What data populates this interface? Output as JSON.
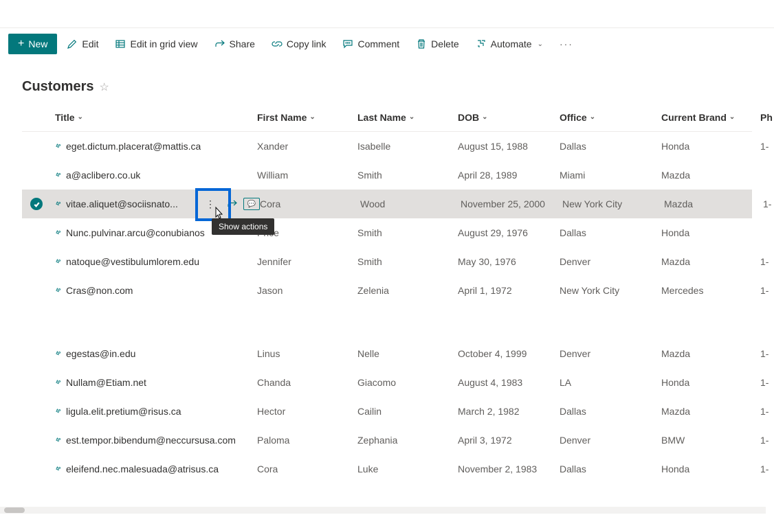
{
  "toolbar": {
    "new_label": "New",
    "edit_label": "Edit",
    "grid_label": "Edit in grid view",
    "share_label": "Share",
    "copy_label": "Copy link",
    "comment_label": "Comment",
    "delete_label": "Delete",
    "automate_label": "Automate"
  },
  "list": {
    "title": "Customers"
  },
  "columns": {
    "title": "Title",
    "first": "First Name",
    "last": "Last Name",
    "dob": "DOB",
    "office": "Office",
    "brand": "Current Brand",
    "phone": "Ph"
  },
  "tooltip": "Show actions",
  "rows": [
    {
      "title": "eget.dictum.placerat@mattis.ca",
      "first": "Xander",
      "last": "Isabelle",
      "dob": "August 15, 1988",
      "office": "Dallas",
      "brand": "Honda",
      "ph": "1-"
    },
    {
      "title": "a@aclibero.co.uk",
      "first": "William",
      "last": "Smith",
      "dob": "April 28, 1989",
      "office": "Miami",
      "brand": "Mazda",
      "ph": ""
    },
    {
      "title": "vitae.aliquet@sociisnato...",
      "first": "Cora",
      "last": "Wood",
      "dob": "November 25, 2000",
      "office": "New York City",
      "brand": "Mazda",
      "ph": "1-"
    },
    {
      "title": "Nunc.pulvinar.arcu@conubianos",
      "first": "Price",
      "last": "Smith",
      "dob": "August 29, 1976",
      "office": "Dallas",
      "brand": "Honda",
      "ph": ""
    },
    {
      "title": "natoque@vestibulumlorem.edu",
      "first": "Jennifer",
      "last": "Smith",
      "dob": "May 30, 1976",
      "office": "Denver",
      "brand": "Mazda",
      "ph": "1-"
    },
    {
      "title": "Cras@non.com",
      "first": "Jason",
      "last": "Zelenia",
      "dob": "April 1, 1972",
      "office": "New York City",
      "brand": "Mercedes",
      "ph": "1-"
    }
  ],
  "rows2": [
    {
      "title": "egestas@in.edu",
      "first": "Linus",
      "last": "Nelle",
      "dob": "October 4, 1999",
      "office": "Denver",
      "brand": "Mazda",
      "ph": "1-"
    },
    {
      "title": "Nullam@Etiam.net",
      "first": "Chanda",
      "last": "Giacomo",
      "dob": "August 4, 1983",
      "office": "LA",
      "brand": "Honda",
      "ph": "1-"
    },
    {
      "title": "ligula.elit.pretium@risus.ca",
      "first": "Hector",
      "last": "Cailin",
      "dob": "March 2, 1982",
      "office": "Dallas",
      "brand": "Mazda",
      "ph": "1-"
    },
    {
      "title": "est.tempor.bibendum@neccursusa.com",
      "first": "Paloma",
      "last": "Zephania",
      "dob": "April 3, 1972",
      "office": "Denver",
      "brand": "BMW",
      "ph": "1-"
    },
    {
      "title": "eleifend.nec.malesuada@atrisus.ca",
      "first": "Cora",
      "last": "Luke",
      "dob": "November 2, 1983",
      "office": "Dallas",
      "brand": "Honda",
      "ph": "1-"
    }
  ]
}
